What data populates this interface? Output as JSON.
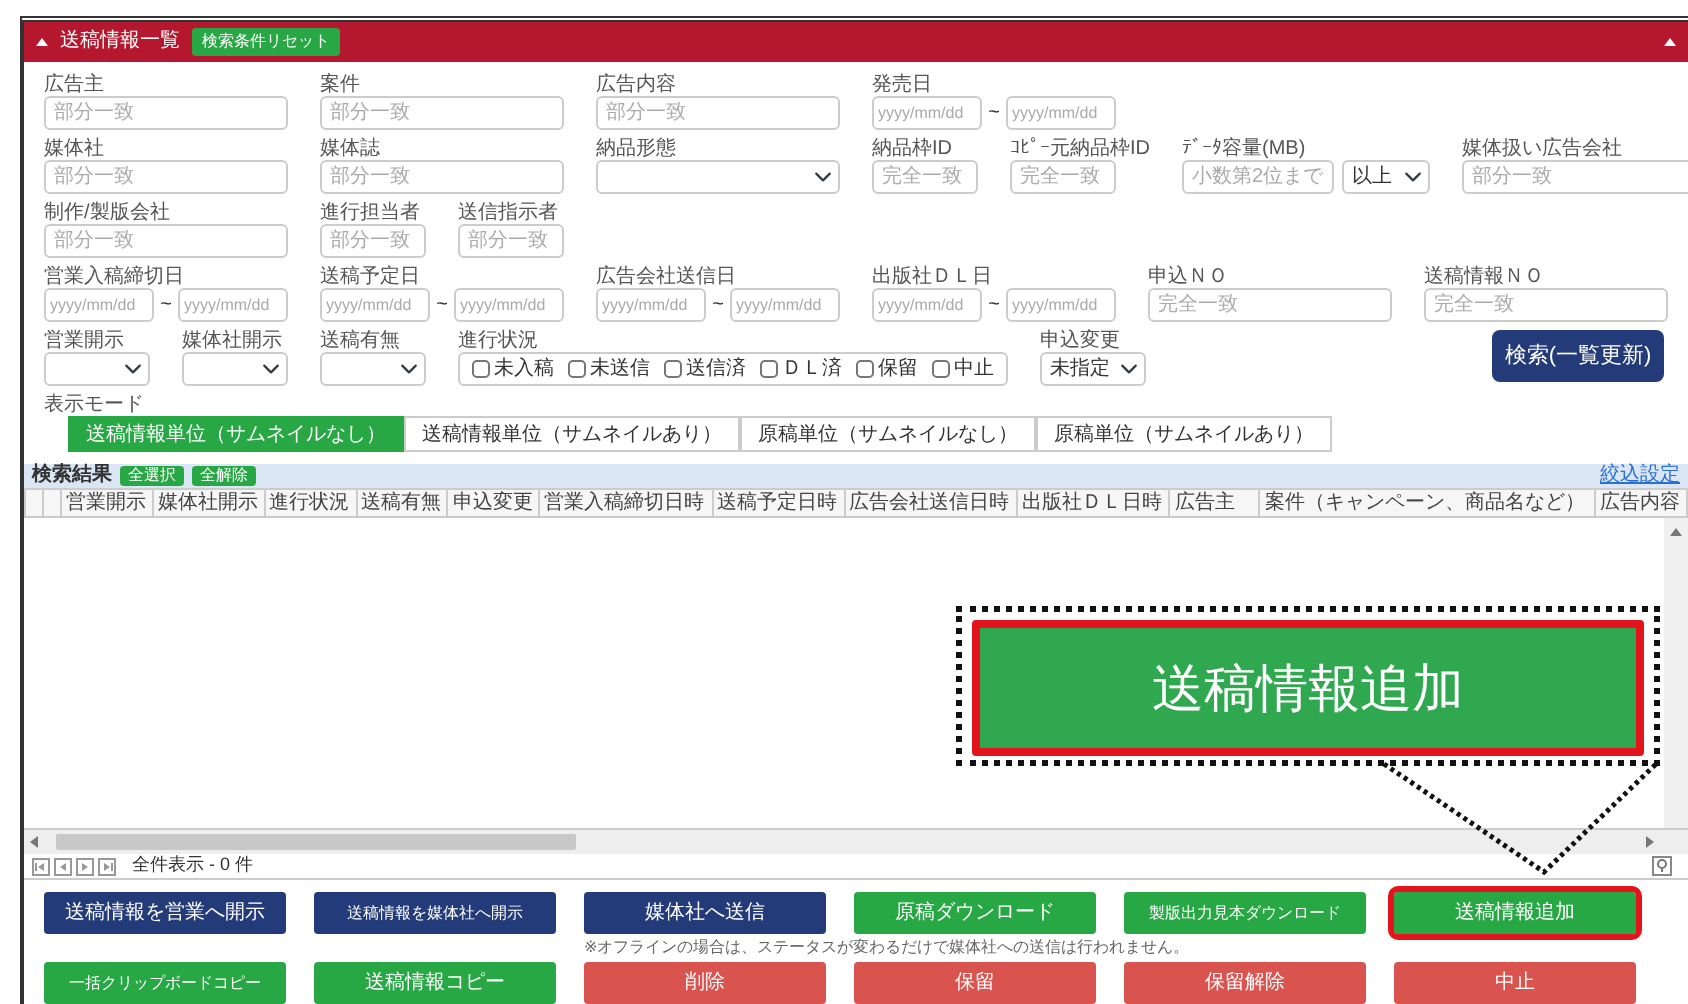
{
  "panel": {
    "title": "送稿情報一覧",
    "reset_button": "検索条件リセット"
  },
  "filters": [
    [
      {
        "label": "広告主",
        "kind": "text",
        "placeholder": "部分一致"
      },
      {
        "label": "案件",
        "kind": "text",
        "placeholder": "部分一致"
      },
      {
        "label": "広告内容",
        "kind": "text",
        "placeholder": "部分一致"
      },
      {
        "label": "発売日",
        "kind": "dates",
        "placeholder_from": "yyyy/mm/dd",
        "separator": "~",
        "placeholder_to": "yyyy/mm/dd"
      }
    ],
    [
      {
        "label": "媒体社",
        "kind": "text",
        "placeholder": "部分一致"
      },
      {
        "label": "媒体誌",
        "kind": "text",
        "placeholder": "部分一致"
      },
      {
        "label": "納品形態",
        "kind": "select"
      },
      {
        "label": "納品枠ID",
        "kind": "short",
        "placeholder": "完全一致"
      },
      {
        "label": "ｺﾋﾟｰ元納品枠ID",
        "kind": "short",
        "placeholder": "完全一致"
      },
      {
        "label": "ﾃﾞｰﾀ容量(MB)",
        "kind": "size",
        "placeholder": "小数第2位まで",
        "value": "以上"
      },
      {
        "label": "媒体扱い広告会社",
        "kind": "text",
        "placeholder": "部分一致"
      }
    ],
    [
      {
        "label": "制作/製版会社",
        "kind": "text",
        "placeholder": "部分一致"
      },
      {
        "label": "進行担当者",
        "kind": "short",
        "placeholder": "部分一致"
      },
      {
        "label": "送信指示者",
        "kind": "short",
        "placeholder": "部分一致"
      }
    ],
    [
      {
        "label": "営業入稿締切日",
        "kind": "dates",
        "placeholder_from": "yyyy/mm/dd",
        "separator": "~",
        "placeholder_to": "yyyy/mm/dd"
      },
      {
        "label": "送稿予定日",
        "kind": "dates",
        "placeholder_from": "yyyy/mm/dd",
        "separator": "~",
        "placeholder_to": "yyyy/mm/dd"
      },
      {
        "label": "広告会社送信日",
        "kind": "dates",
        "placeholder_from": "yyyy/mm/dd",
        "separator": "~",
        "placeholder_to": "yyyy/mm/dd"
      },
      {
        "label": "出版社ＤＬ日",
        "kind": "dates",
        "placeholder_from": "yyyy/mm/dd",
        "separator": "~",
        "placeholder_to": "yyyy/mm/dd"
      },
      {
        "label": "申込ＮＯ",
        "kind": "text",
        "placeholder": "完全一致"
      },
      {
        "label": "送稿情報ＮＯ",
        "kind": "text",
        "placeholder": "完全一致"
      }
    ],
    [
      {
        "label": "営業開示",
        "kind": "short-select"
      },
      {
        "label": "媒体社開示",
        "kind": "short-select"
      },
      {
        "label": "送稿有無",
        "kind": "short-select"
      },
      {
        "label": "進行状況",
        "kind": "checks",
        "options": [
          {
            "label": "未入稿",
            "checked": false
          },
          {
            "label": "未送信",
            "checked": false
          },
          {
            "label": "送信済",
            "checked": false
          },
          {
            "label": "ＤＬ済",
            "checked": false
          },
          {
            "label": "保留",
            "checked": false
          },
          {
            "label": "中止",
            "checked": false
          }
        ]
      },
      {
        "label": "申込変更",
        "kind": "short-select",
        "value": "未指定"
      }
    ]
  ],
  "search_button": "検索(一覧更新)",
  "display_mode": {
    "label": "表示モード",
    "options": [
      {
        "label": "送稿情報単位（サムネイルなし）",
        "selected": true
      },
      {
        "label": "送稿情報単位（サムネイルあり）",
        "selected": false
      },
      {
        "label": "原稿単位（サムネイルなし）",
        "selected": false
      },
      {
        "label": "原稿単位（サムネイルあり）",
        "selected": false
      }
    ]
  },
  "results": {
    "title": "検索結果",
    "select_all": "全選択",
    "deselect_all": "全解除",
    "filter_link": "絞込設定",
    "columns": [
      "営業開示",
      "媒体社開示",
      "進行状況",
      "送稿有無",
      "申込変更",
      "営業入稿締切日時",
      "送稿予定日時",
      "広告会社送信日時",
      "出版社ＤＬ日時",
      "広告主",
      "案件（キャンペーン、商品名など）",
      "広告内容"
    ],
    "pager_text": "全件表示 - 0 件"
  },
  "actions": [
    [
      {
        "label": "送稿情報を営業へ開示",
        "kind": "navy",
        "highlighted": false
      },
      {
        "label": "送稿情報を媒体社へ開示",
        "kind": "navy",
        "highlighted": false
      },
      {
        "label": "媒体社へ送信",
        "kind": "navy",
        "highlighted": false
      },
      {
        "label": "原稿ダウンロード",
        "kind": "green",
        "highlighted": false
      },
      {
        "label": "製版出力見本ダウンロード",
        "kind": "green",
        "highlighted": false
      },
      {
        "label": "送稿情報追加",
        "kind": "green",
        "highlighted": true
      }
    ],
    [
      {
        "label": "一括クリップボードコピー",
        "kind": "green",
        "highlighted": false
      },
      {
        "label": "送稿情報コピー",
        "kind": "green",
        "highlighted": false
      },
      {
        "label": "削除",
        "kind": "red",
        "highlighted": false
      },
      {
        "label": "保留",
        "kind": "red",
        "highlighted": false
      },
      {
        "label": "保留解除",
        "kind": "red",
        "highlighted": false
      },
      {
        "label": "中止",
        "kind": "red",
        "highlighted": false
      }
    ]
  ],
  "note": "※オフラインの場合は、ステータスが変わるだけで媒体社への送信は行われません。",
  "callout": {
    "label": "送稿情報追加"
  }
}
